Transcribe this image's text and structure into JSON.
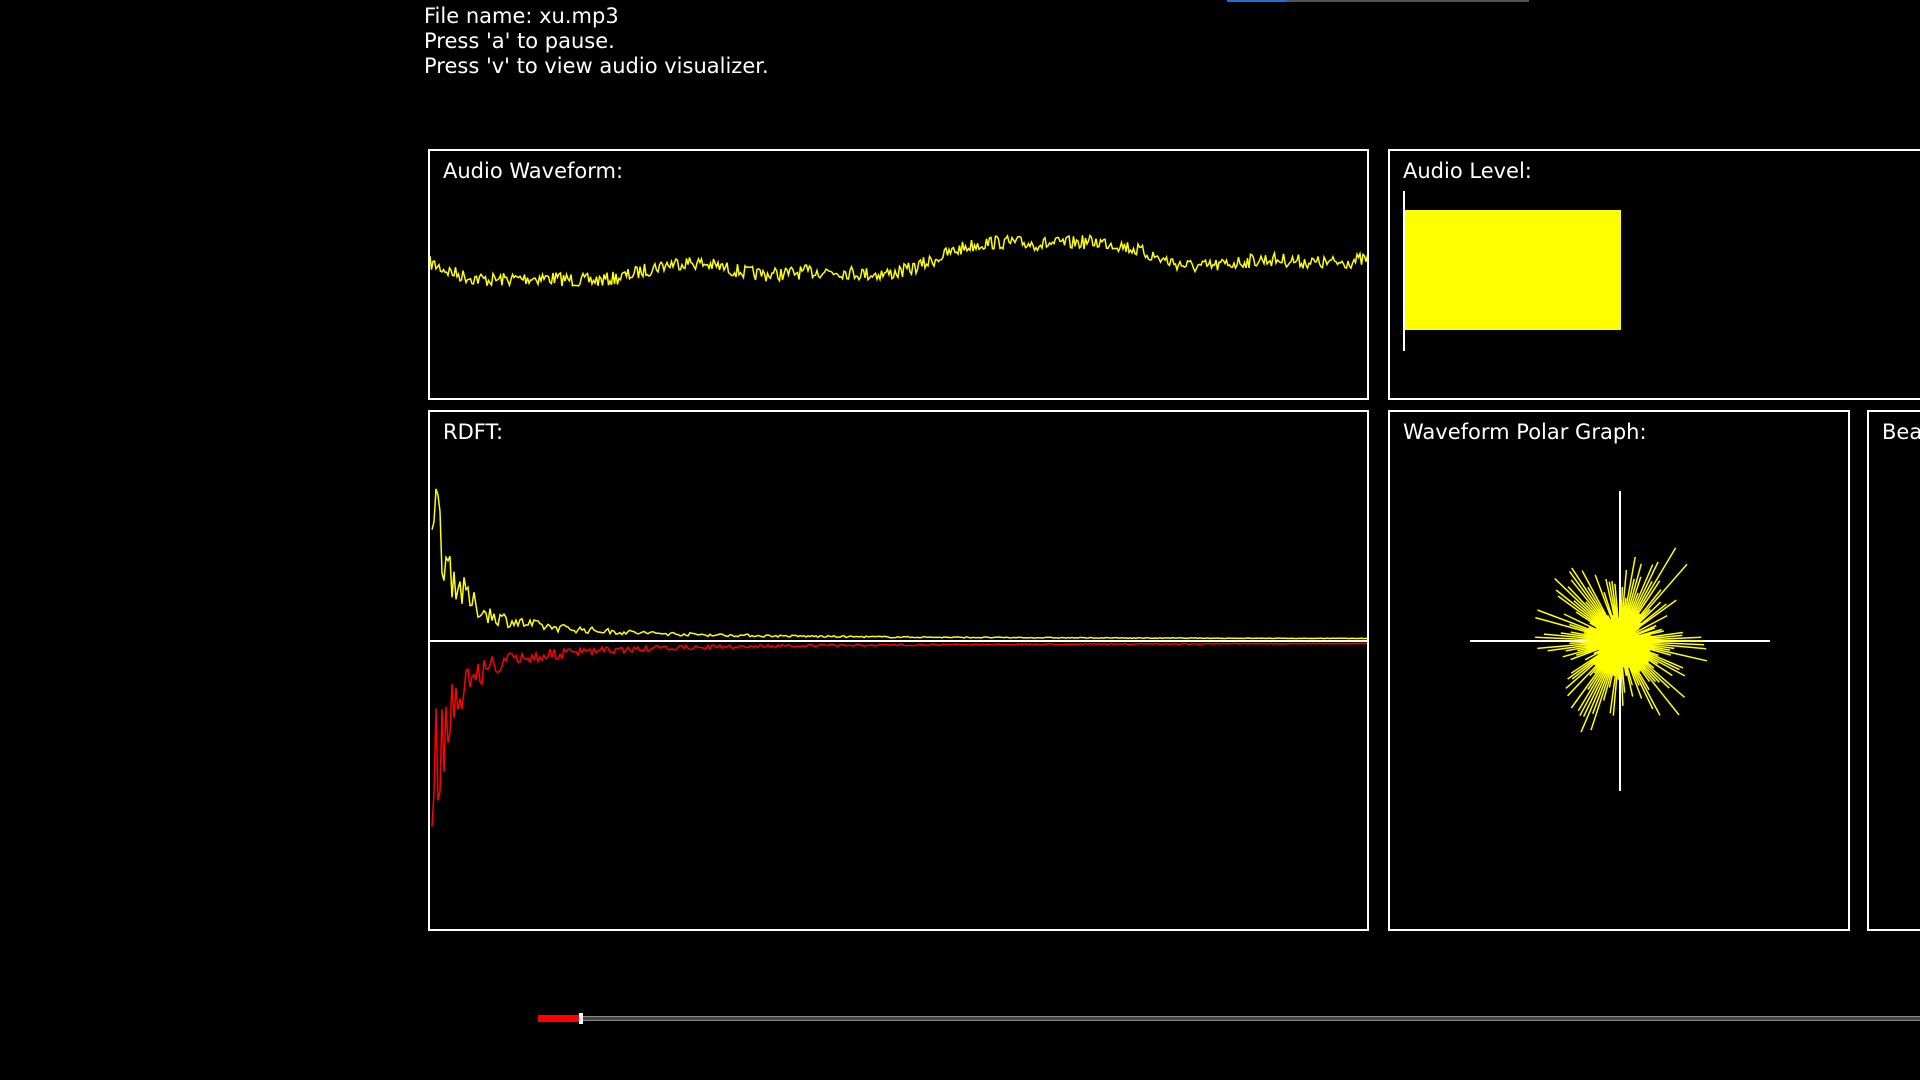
{
  "info": {
    "file_line": "File name: xu.mp3",
    "pause_hint": "Press 'a' to pause.",
    "visualizer_hint": "Press 'v' to view audio visualizer."
  },
  "panels": {
    "waveform": {
      "title": "Audio Waveform:",
      "color": "#ffff00"
    },
    "level": {
      "title": "Audio Level:",
      "value": 0.36,
      "color": "#ffff00"
    },
    "rdft": {
      "title": "RDFT:",
      "positive_color": "#ffff00",
      "negative_color": "#ff0000"
    },
    "polar": {
      "title": "Waveform Polar Graph:",
      "color": "#ffff00"
    },
    "beat": {
      "title": "Bea"
    }
  },
  "playback": {
    "progress": 0.03,
    "progress_color": "#ff0000"
  },
  "top_indicator": {
    "progress": 0.2,
    "color": "#1e6fd9"
  }
}
